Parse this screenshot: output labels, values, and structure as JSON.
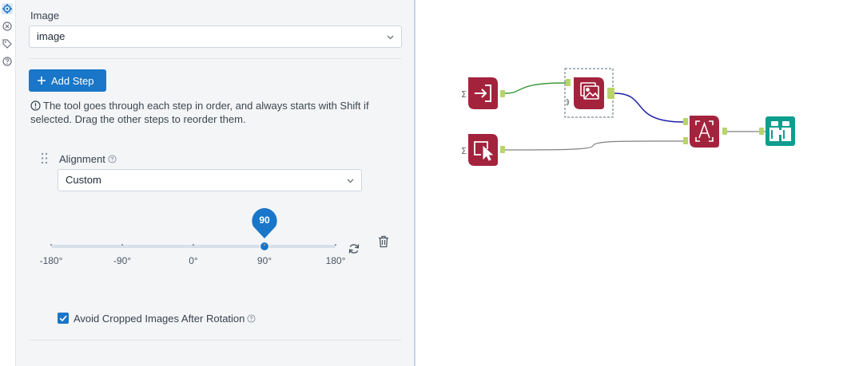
{
  "rail": {
    "icons": [
      "gear-icon",
      "connect-icon",
      "tag-icon",
      "help-icon"
    ]
  },
  "config": {
    "image_label": "Image",
    "image_select": "image",
    "add_step_label": "Add Step",
    "info_text": "The tool goes through each step in order, and always starts with Shift if selected. Drag the other steps to reorder them.",
    "alignment_label": "Alignment",
    "alignment_select": "Custom",
    "slider": {
      "min": -180,
      "max": 180,
      "value": 90,
      "value_label": "90",
      "tick_labels": [
        "-180°",
        "-90°",
        "0°",
        "90°",
        "180°"
      ]
    },
    "avoid_crop_label": "Avoid Cropped Images After Rotation",
    "avoid_crop_checked": true
  },
  "colors": {
    "accent": "#1976c8",
    "tool_red": "#a3233d",
    "tool_teal": "#0e9e8e",
    "anchor_green": "#b8d46a"
  },
  "workflow": {
    "tools": [
      {
        "id": "input",
        "icon": "input-data-icon"
      },
      {
        "id": "image",
        "icon": "image-icon",
        "selected": true
      },
      {
        "id": "select-region",
        "icon": "select-region-icon"
      },
      {
        "id": "ocr",
        "icon": "image-to-text-icon"
      },
      {
        "id": "browse",
        "icon": "binoculars-icon"
      }
    ]
  }
}
